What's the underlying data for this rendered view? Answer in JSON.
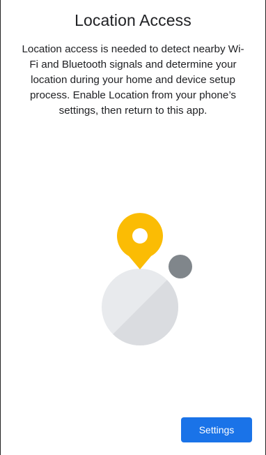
{
  "screen": {
    "title": "Location Access",
    "description": "Location access is needed to detect nearby Wi-Fi and Bluetooth signals and determine your location during your home and device setup process. Enable Location from your phone’s settings, then return to this app."
  },
  "illustration": {
    "pin_icon": "location-pin-icon",
    "pin_color": "#fbbc04",
    "circle_color": "#e8eaed",
    "circle_shade_color": "#dadce0",
    "dot_color": "#80868b"
  },
  "actions": {
    "settings_label": "Settings",
    "accent_color": "#1a73e8"
  }
}
